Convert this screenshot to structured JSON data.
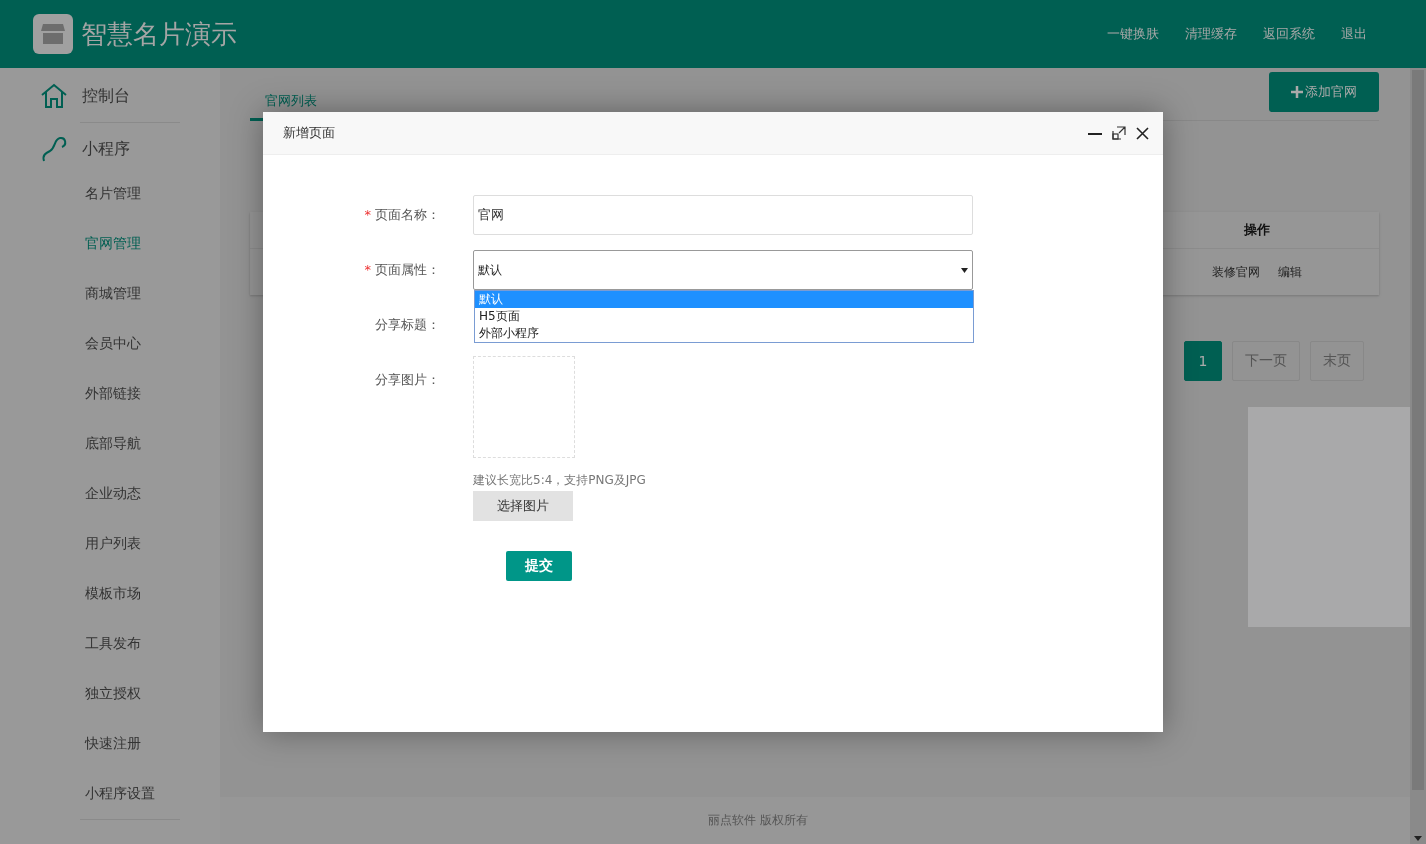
{
  "header": {
    "title": "智慧名片演示",
    "links": [
      "一键换肤",
      "清理缓存",
      "返回系统",
      "退出"
    ]
  },
  "sidebar": {
    "items": [
      {
        "kind": "section",
        "label": "控制台",
        "selected": false
      },
      {
        "kind": "section",
        "label": "小程序",
        "selected": false
      },
      {
        "kind": "item",
        "label": "名片管理",
        "selected": false
      },
      {
        "kind": "item",
        "label": "官网管理",
        "selected": true
      },
      {
        "kind": "item",
        "label": "商城管理",
        "selected": false
      },
      {
        "kind": "item",
        "label": "会员中心",
        "selected": false
      },
      {
        "kind": "item",
        "label": "外部链接",
        "selected": false
      },
      {
        "kind": "item",
        "label": "底部导航",
        "selected": false
      },
      {
        "kind": "item",
        "label": "企业动态",
        "selected": false
      },
      {
        "kind": "item",
        "label": "用户列表",
        "selected": false
      },
      {
        "kind": "item",
        "label": "模板市场",
        "selected": false
      },
      {
        "kind": "item",
        "label": "工具发布",
        "selected": false
      },
      {
        "kind": "item",
        "label": "独立授权",
        "selected": false
      },
      {
        "kind": "item",
        "label": "快速注册",
        "selected": false
      },
      {
        "kind": "item",
        "label": "小程序设置",
        "selected": false
      }
    ]
  },
  "main": {
    "tabs": [
      {
        "label": "官网列表",
        "selected": true
      }
    ],
    "add_button": "添加官网",
    "table": {
      "columns": [
        "操作"
      ],
      "rows": [
        {
          "actions": [
            "装修官网",
            "编辑"
          ]
        }
      ]
    },
    "pagination": {
      "pages": [
        {
          "label": "1",
          "selected": true
        }
      ],
      "next": "下一页",
      "last": "末页"
    }
  },
  "dialog": {
    "title": "新增页面",
    "required_mark": "*",
    "fields": [
      {
        "kind": "text",
        "label": "页面名称：",
        "required": true,
        "value": "官网"
      },
      {
        "kind": "select",
        "label": "页面属性：",
        "required": true,
        "value": "默认",
        "expanded": true,
        "options": [
          {
            "label": "默认",
            "selected": true
          },
          {
            "label": "H5页面",
            "selected": false
          },
          {
            "label": "外部小程序",
            "selected": false
          }
        ]
      },
      {
        "kind": "text",
        "label": "分享标题：",
        "required": false
      },
      {
        "kind": "image",
        "label": "分享图片：",
        "required": false,
        "hint": "建议长宽比5:4，支持PNG及JPG",
        "button": "选择图片"
      }
    ],
    "submit": "提交"
  },
  "footer": "丽点软件 版权所有"
}
